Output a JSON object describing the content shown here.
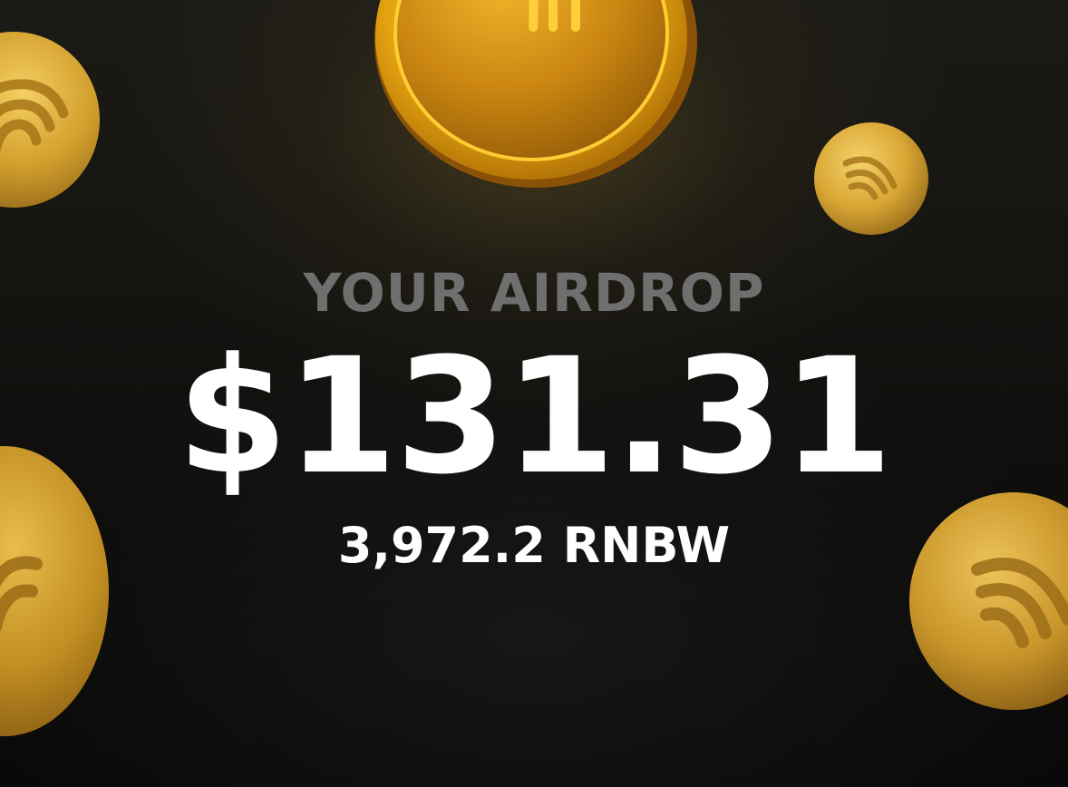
{
  "airdrop": {
    "label": "YOUR AIRDROP",
    "amount_usd": "$131.31",
    "amount_tokens": "3,972.2 RNBW"
  },
  "colors": {
    "background": "#0c0c0b",
    "label": "#6f6f6f",
    "amount": "#ffffff",
    "coin_gold": "#e0a81c"
  },
  "icons": {
    "coin": "rainbow-coin-icon"
  }
}
